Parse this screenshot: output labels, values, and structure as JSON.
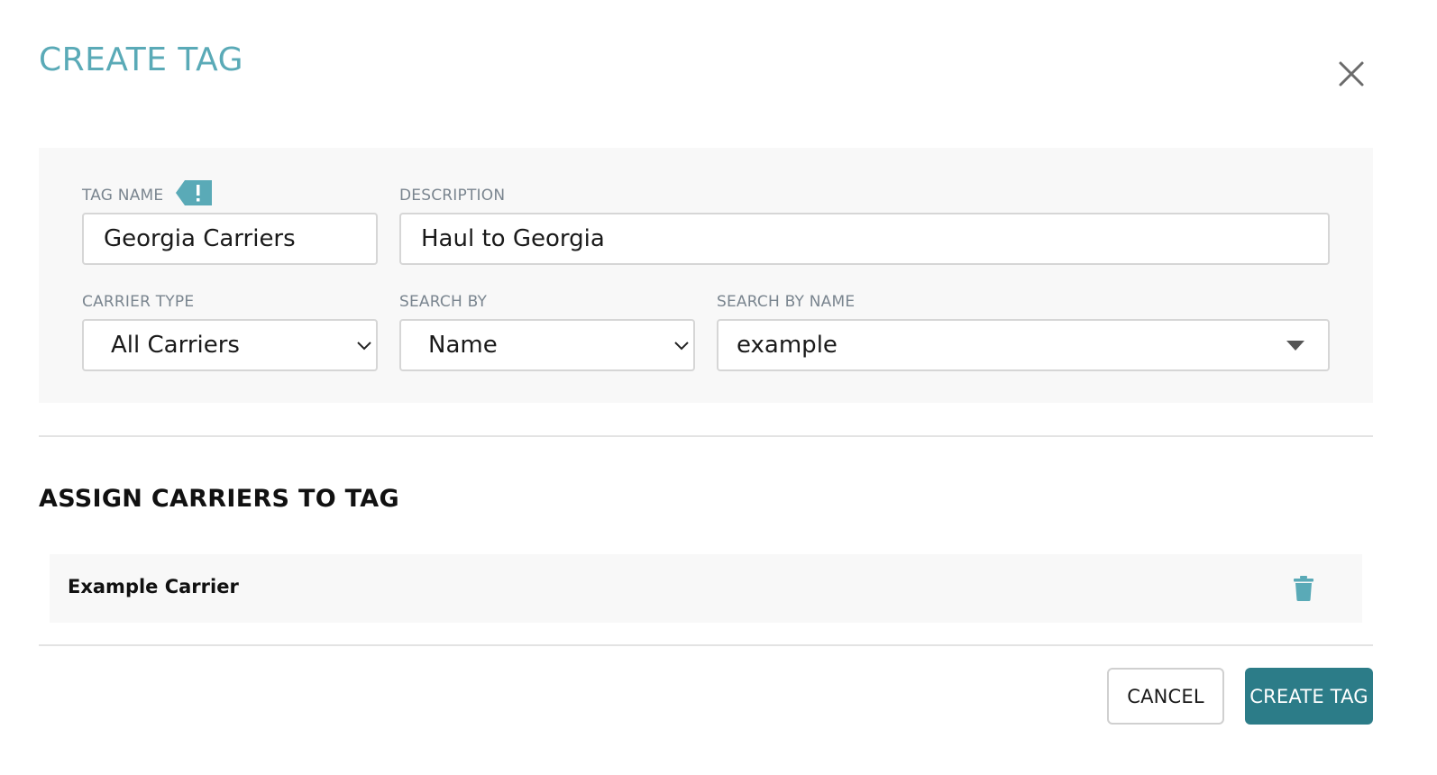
{
  "modal": {
    "title": "CREATE TAG"
  },
  "form": {
    "tag_name": {
      "label": "TAG NAME",
      "value": "Georgia Carriers"
    },
    "description": {
      "label": "DESCRIPTION",
      "value": "Haul to Georgia"
    },
    "carrier_type": {
      "label": "CARRIER TYPE",
      "selected": "All Carriers"
    },
    "search_by": {
      "label": "SEARCH BY",
      "selected": "Name"
    },
    "search_by_name": {
      "label": "SEARCH BY NAME",
      "value": "example"
    }
  },
  "assign": {
    "title": "ASSIGN CARRIERS TO TAG",
    "carriers": [
      {
        "name": "Example Carrier"
      }
    ]
  },
  "footer": {
    "cancel_label": "CANCEL",
    "create_label": "CREATE TAG"
  },
  "colors": {
    "accent": "#5aaab7",
    "primary_button": "#2c7c88",
    "icon_teal": "#5aaab7"
  },
  "icons": {
    "close": "close-icon",
    "tag_badge": "tag-alert-icon",
    "chevron": "chevron-down-icon",
    "caret": "caret-down-icon",
    "trash": "trash-icon"
  }
}
